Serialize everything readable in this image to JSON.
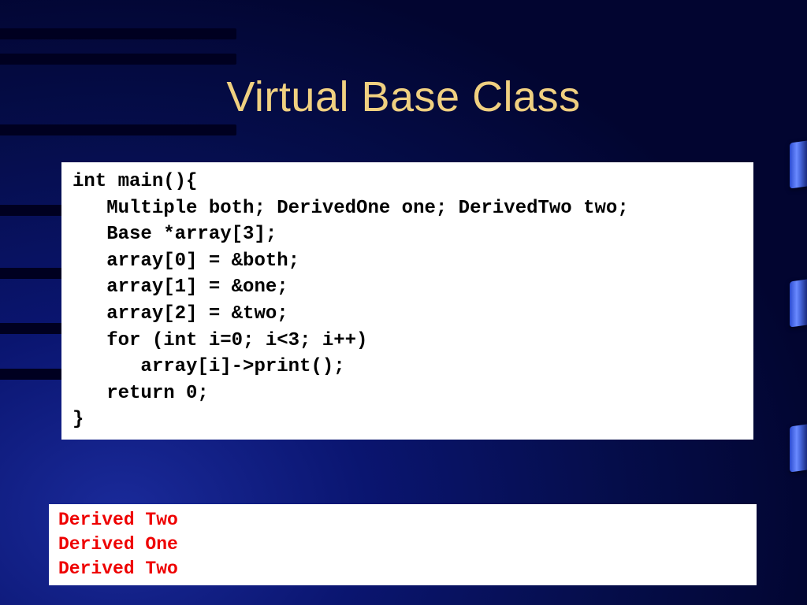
{
  "title": "Virtual Base Class",
  "code": "int main(){\n   Multiple both; DerivedOne one; DerivedTwo two;\n   Base *array[3];\n   array[0] = &both;\n   array[1] = &one;\n   array[2] = &two;\n   for (int i=0; i<3; i++)\n      array[i]->print();\n   return 0;\n}",
  "output": "Derived Two\nDerived One\nDerived Two",
  "stripes_top": [
    36,
    68,
    158,
    260,
    340,
    410,
    468
  ],
  "ribbons_top": [
    180,
    356,
    540
  ]
}
